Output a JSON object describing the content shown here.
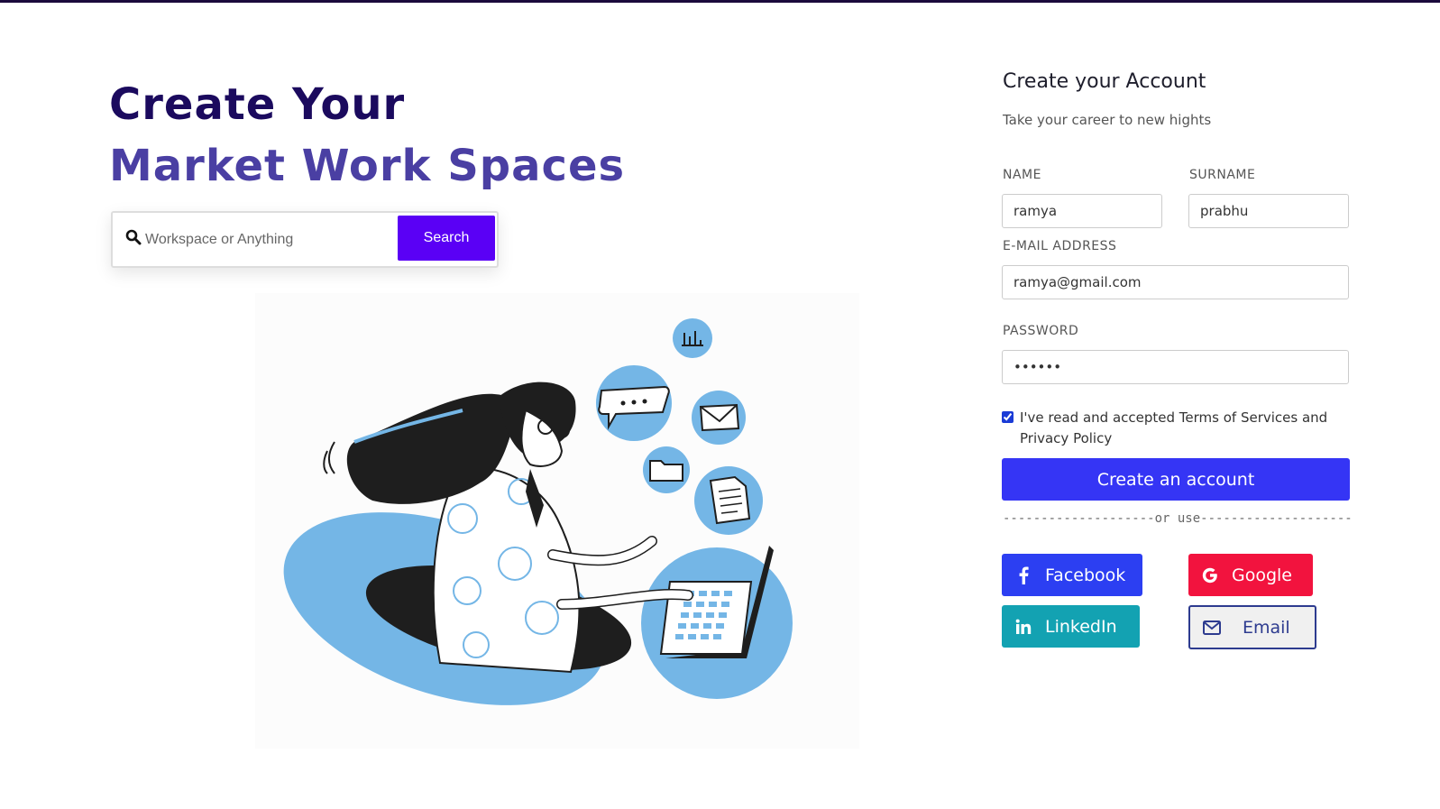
{
  "hero": {
    "line1": "Create Your",
    "line2": "Market Work Spaces"
  },
  "search": {
    "placeholder": "Workspace or Anything",
    "button_label": "Search",
    "icon": "search-icon"
  },
  "illustration": {
    "icons": [
      "chart-icon",
      "chat-bubble-icon",
      "mail-icon",
      "folder-icon",
      "document-icon",
      "laptop-icon"
    ]
  },
  "form": {
    "title": "Create your Account",
    "subtitle": "Take your career to new hights",
    "name_label": "NAME",
    "name_value": "ramya",
    "surname_label": "SURNAME",
    "surname_value": "prabhu",
    "email_label": "E-MAIL ADDRESS",
    "email_value": "ramya@gmail.com",
    "password_label": "PASSWORD",
    "password_value": "••••••",
    "terms_text": "I've read and accepted Terms of Services and Privacy Policy",
    "terms_checked": true,
    "submit_label": "Create an account",
    "divider_text": "--------------------or use---------------------"
  },
  "social": {
    "facebook_label": "Facebook",
    "google_label": "Google",
    "linkedin_label": "LinkedIn",
    "email_label": "Email"
  },
  "colors": {
    "title_dark": "#1b0a5e",
    "title_light": "#4a3fa3",
    "search_button": "#5a00f5",
    "create_button": "#3535f5",
    "facebook": "#2c3ff2",
    "google": "#f2133e",
    "linkedin": "#13a2b2",
    "email_border": "#2d3b8f",
    "illustration_blue": "#74b6e6"
  }
}
